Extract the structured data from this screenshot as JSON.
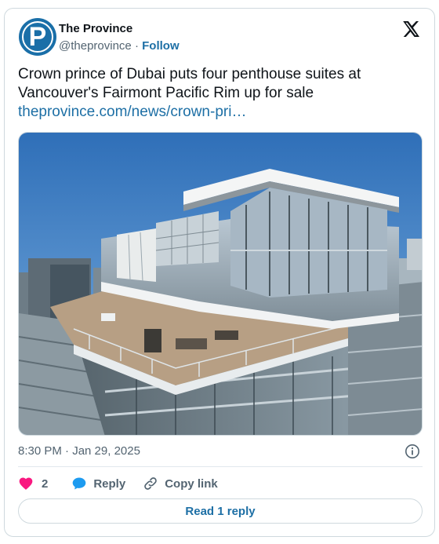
{
  "author": {
    "avatar_letter": "P",
    "name": "The Province",
    "handle": "@theprovince",
    "separator": " · ",
    "follow_label": "Follow"
  },
  "tweet": {
    "text": "Crown prince of Dubai puts four penthouse suites at Vancouver's Fairmont Pacific Rim up for sale",
    "link": "theprovince.com/news/crown-pri…",
    "timestamp": "8:30 PM · Jan 29, 2025"
  },
  "actions": {
    "like_count": "2",
    "reply_label": "Reply",
    "copy_link_label": "Copy link"
  },
  "read_replies_label": "Read 1 reply",
  "colors": {
    "link": "#1d6fa5",
    "like": "#f91880",
    "reply_bubble": "#1d9bf0",
    "avatar_bg": "#1a6fa8",
    "secondary_text": "#536471"
  },
  "icons": {
    "brand": "x-logo-icon",
    "info": "info-icon",
    "like": "heart-icon",
    "reply": "chat-bubble-icon",
    "copy": "link-icon"
  }
}
